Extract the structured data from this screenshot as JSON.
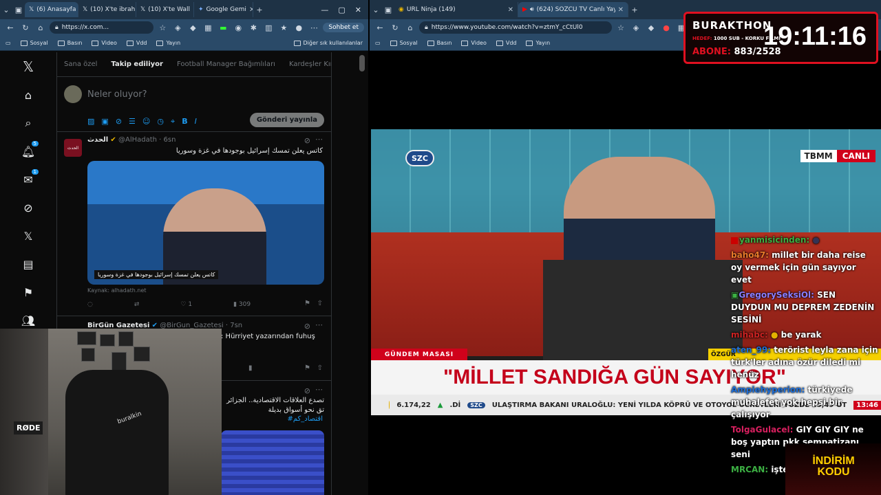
{
  "left_window": {
    "tabs": [
      {
        "label": "(6) Anasayfa",
        "active": true
      },
      {
        "label": "(10) X'te ibrah",
        "active": false
      },
      {
        "label": "(10) X'te Wall",
        "active": false
      },
      {
        "label": "Google Gemi",
        "active": false
      }
    ],
    "url": "https://x.com...",
    "copilot_label": "Sohbet et",
    "bookmarks": [
      "Sosyal",
      "Basın",
      "Video",
      "Vdd",
      "Yayın"
    ],
    "other_bookmarks": "Diğer sık kullanılanlar"
  },
  "right_window": {
    "tabs": [
      {
        "label": "URL Ninja (149)",
        "active": false
      },
      {
        "label": "(624) SÖZCÜ TV Canlı Yayını",
        "active": true
      }
    ],
    "url": "https://www.youtube.com/watch?v=ztmY_cCtUl0",
    "bookmarks": [
      "Sosyal",
      "Basın",
      "Video",
      "Vdd",
      "Yayın"
    ]
  },
  "x_sidebar": {
    "notifications_badge": "5",
    "messages_badge": "1"
  },
  "feed_tabs": [
    "Sana özel",
    "Takip ediliyor",
    "Football Manager Bağımlıları",
    "Kardeşler Kıraath"
  ],
  "compose": {
    "placeholder": "Neler oluyor?",
    "post_button": "Gönderi yayınla"
  },
  "tweets": [
    {
      "name": "الحدث",
      "handle": "@AlHadath · 6sn",
      "avatar_text": "الحدث",
      "text": "كاتس يعلن تمسك إسرائيل بوجودها في غزة وسوريا",
      "image_caption": "كاتس يعلن تمسك إسرائيل بوجودها في غزة وسوريا",
      "source": "Kaynak: alhadath.net",
      "likes": "1",
      "views": "309"
    },
    {
      "name": "BirGün Gazetesi",
      "handle": "@BirGun_Gazetesi · 7sn",
      "text": ": Hürriyet yazarından fuhuş"
    },
    {
      "text": "تصدع العلاقات الاقتصادية.. الجزائر تق نحو أسواق بديلة",
      "hashtag": "#اقتصاد_كم"
    }
  ],
  "webcam": {
    "mic_brand": "RØDE",
    "chair_brand": "buralkin"
  },
  "broadcast": {
    "channel_logo": "SZC",
    "tbmm": "TBMM",
    "live": "CANLI",
    "segment": "GÜNDEM MASASI",
    "name_bar": "ÖZGÜR",
    "headline": "\"MİLLET SANDIĞA GÜN SAYIYOR\"",
    "ticker_value": "6.174,22",
    "ticker_arrow": "▲",
    "ticker_di": ".Dİ",
    "ticker_text": "ULAŞTIRMA BAKANI URALOĞLU: YENİ YILDA KÖPRÜ VE OTOYOL ÜCRETLERİ YÜZDE 25,49 OT",
    "ticker_time": "13:46"
  },
  "overlay": {
    "title": "BURAKTHON",
    "goal_label": "HEDEF:",
    "goal_text": "1000 SUB - KORKU FİLMİ",
    "sub_label": "ABONE:",
    "sub_count": "883/2528",
    "clock": "19:11:16"
  },
  "chat": [
    {
      "user": "yanmisicinden:",
      "msg": "",
      "color": "u1"
    },
    {
      "user": "baho47:",
      "msg": "millet bir daha reise oy vermek için gün sayıyor evet",
      "color": "u2"
    },
    {
      "user": "GregorySeksiOl:",
      "msg": "SEN DUYDUN MU DEPREM ZEDENİN SESİNİ",
      "color": "u5"
    },
    {
      "user": "mihabc:",
      "msg": "be yarak",
      "color": "u3"
    },
    {
      "user": "aten_99:",
      "msg": "terörist leyla zana için türk'ler adına özür diledi mi henüz",
      "color": "u4"
    },
    {
      "user": "Ampiehyperion:",
      "msg": "türkiyede muhalefet yok hepsi bir çalışıyor",
      "color": "u4"
    },
    {
      "user": "TolgaGulacel:",
      "msg": "GIY GIY GIY ne boş yaptın pkk sempatizanı seni",
      "color": "u6"
    },
    {
      "user": "MRCAN:",
      "msg": "işte anlamıyolar ki",
      "color": "u7"
    }
  ],
  "promo": "İNDİRİM KODU"
}
